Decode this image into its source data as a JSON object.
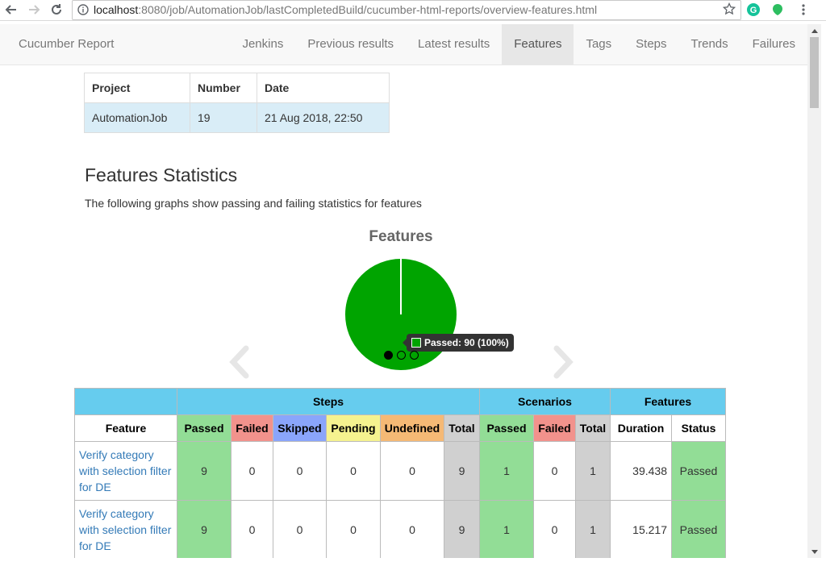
{
  "browser": {
    "url_host": "localhost",
    "url_rest": ":8080/job/AutomationJob/lastCompletedBuild/cucumber-html-reports/overview-features.html"
  },
  "navbar": {
    "brand": "Cucumber Report",
    "items": [
      {
        "label": "Jenkins"
      },
      {
        "label": "Previous results"
      },
      {
        "label": "Latest results"
      },
      {
        "label": "Features",
        "active": true
      },
      {
        "label": "Tags"
      },
      {
        "label": "Steps"
      },
      {
        "label": "Trends"
      },
      {
        "label": "Failures"
      }
    ]
  },
  "build_info": {
    "headers": [
      "Project",
      "Number",
      "Date"
    ],
    "row": [
      "AutomationJob",
      "19",
      "21 Aug 2018, 22:50"
    ]
  },
  "section": {
    "title": "Features Statistics",
    "description": "The following graphs show passing and failing statistics for features"
  },
  "chart_data": {
    "type": "pie",
    "title": "Features",
    "slices": [
      {
        "label": "Passed",
        "value": 90,
        "percent": 100,
        "color": "#00a400"
      }
    ],
    "tooltip": "Passed: 90 (100%)",
    "carousel_pages": 3,
    "carousel_active": 0
  },
  "stats_table": {
    "groups": [
      "Steps",
      "Scenarios",
      "Features"
    ],
    "headers": {
      "feature": "Feature",
      "steps": [
        "Passed",
        "Failed",
        "Skipped",
        "Pending",
        "Undefined",
        "Total"
      ],
      "scenarios": [
        "Passed",
        "Failed",
        "Total"
      ],
      "features": [
        "Duration",
        "Status"
      ]
    },
    "rows": [
      {
        "feature": "Verify category with selection filter for DE",
        "steps": [
          "9",
          "0",
          "0",
          "0",
          "0",
          "9"
        ],
        "scenarios": [
          "1",
          "0",
          "1"
        ],
        "duration": "39.438",
        "status": "Passed"
      },
      {
        "feature": "Verify category with selection filter for DE",
        "steps": [
          "9",
          "0",
          "0",
          "0",
          "0",
          "9"
        ],
        "scenarios": [
          "1",
          "0",
          "1"
        ],
        "duration": "15.217",
        "status": "Passed"
      }
    ]
  },
  "colors": {
    "passed": "#92dd96",
    "failed": "#f2928c",
    "skipped": "#8aa5fb",
    "pending": "#f5f28f",
    "undefined": "#f5b975",
    "total": "#d0d0d0",
    "group_header": "#66ccee"
  }
}
